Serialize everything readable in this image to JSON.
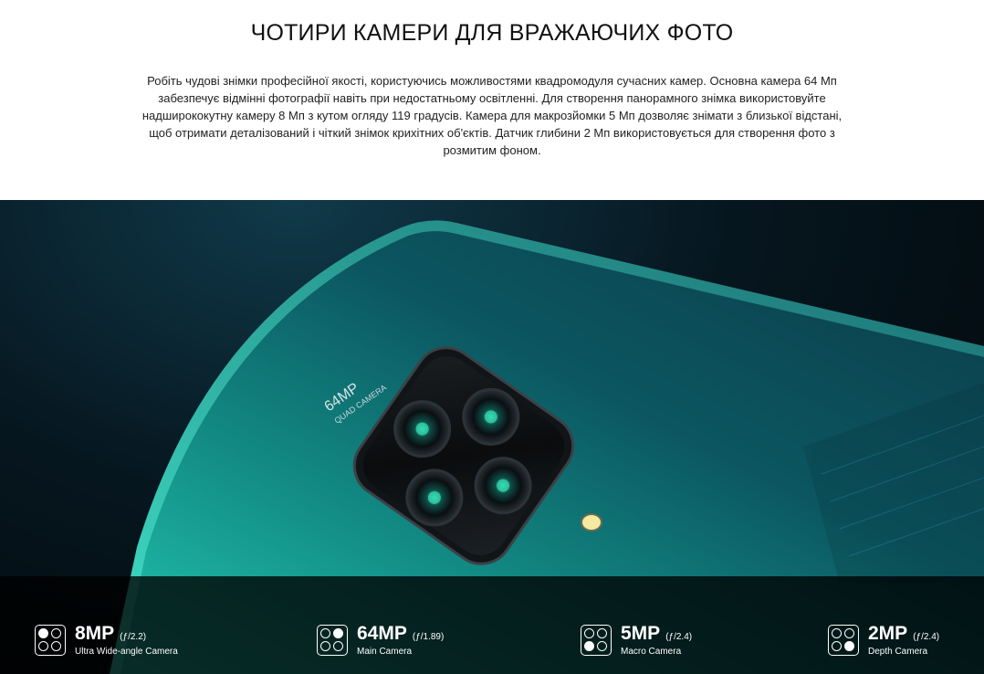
{
  "section": {
    "title": "ЧОТИРИ КАМЕРИ ДЛЯ ВРАЖАЮЧИХ ФОТО",
    "description": "Робіть чудові знімки професійної якості, користуючись можливостями квадромодуля сучасних камер. Основна камера 64 Мп забезпечує відмінні фотографії навіть при недостатньому освітленні. Для створення панорамного знімка використовуйте надширококутну камеру 8 Мп з кутом огляду 119 градусів. Камера для макрозйомки 5 Мп дозволяє знімати з близької відстані, щоб отримати деталізований і чіткий знімок крихітних об'єктів. Датчик глибини 2 Мп використовується для створення фото з розмитим фоном."
  },
  "hero": {
    "module_mp": "64MP",
    "module_label": "QUAD CAMERA"
  },
  "specs": [
    {
      "mp": "8MP",
      "aperture": "(ƒ/2.2)",
      "name": "Ultra Wide-angle Camera",
      "active_dot": "top-left"
    },
    {
      "mp": "64MP",
      "aperture": "(ƒ/1.89)",
      "name": "Main Camera",
      "active_dot": "top-right"
    },
    {
      "mp": "5MP",
      "aperture": "(ƒ/2.4)",
      "name": "Macro Camera",
      "active_dot": "bottom-left"
    },
    {
      "mp": "2MP",
      "aperture": "(ƒ/2.4)",
      "name": "Depth Camera",
      "active_dot": "bottom-right"
    }
  ],
  "colors": {
    "phone_teal": "#1fb5a3",
    "background_dark": "#04121a",
    "bar_overlay": "#000000"
  }
}
